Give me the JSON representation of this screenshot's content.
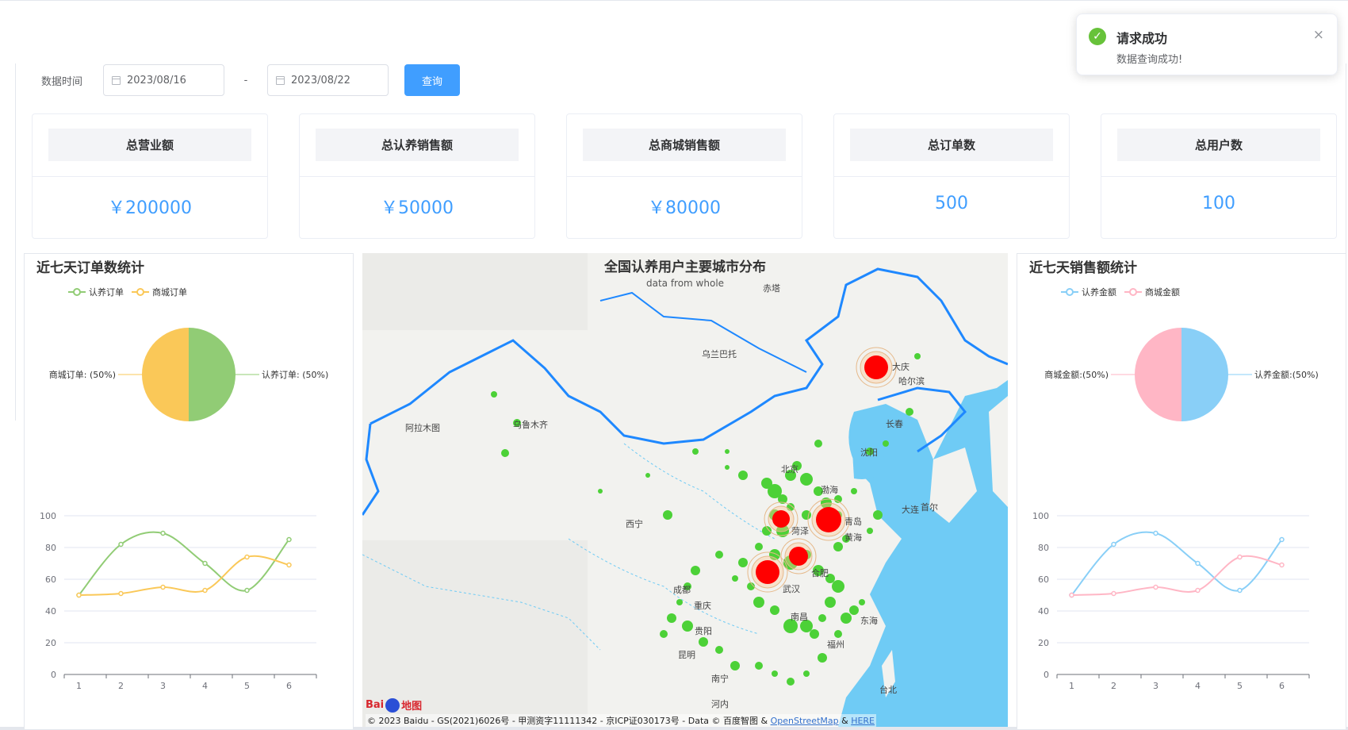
{
  "filter": {
    "label": "数据时间",
    "start_date": "2023/08/16",
    "separator": "-",
    "end_date": "2023/08/22",
    "query_button": "查询"
  },
  "cards": [
    {
      "title": "总营业额",
      "value": "￥200000"
    },
    {
      "title": "总认养销售额",
      "value": "￥50000"
    },
    {
      "title": "总商城销售额",
      "value": "￥80000"
    },
    {
      "title": "总订单数",
      "value": "500"
    },
    {
      "title": "总用户数",
      "value": "100"
    }
  ],
  "toast": {
    "title": "请求成功",
    "message": "数据查询成功!",
    "close": "×",
    "icon": "success-check-icon"
  },
  "colors": {
    "accent": "#409eff",
    "green": "#91cc75",
    "yellow": "#fac858",
    "blue": "#89cff7",
    "pink": "#ffb6c5",
    "map_red": "#ff0000",
    "map_green": "#4cd137",
    "sea": "#6fcbf5",
    "border": "#1e88ff"
  },
  "left_panel": {
    "title": "近七天订单数统计",
    "legend": [
      "认养订单",
      "商城订单"
    ]
  },
  "right_panel": {
    "title": "近七天销售额统计",
    "legend": [
      "认养金额",
      "商城金额"
    ]
  },
  "map": {
    "title": "全国认养用户主要城市分布",
    "subtitle": "data from whole",
    "copyright_prefix": "© 2023 Baidu - GS(2021)6026号 - 甲测资字11111342 - 京ICP证030173号 - Data © 百度智图 & ",
    "osm": "OpenStreetMap",
    "amp": " & ",
    "here": "HERE",
    "logo_left": "Bai",
    "logo_right": "地图",
    "labels": [
      "大庆",
      "哈尔滨",
      "长春",
      "乌兰巴托",
      "乌鲁木齐",
      "阿拉木图",
      "北京",
      "渤海",
      "青岛",
      "黄海",
      "菏泽",
      "合肥",
      "武汉",
      "东海",
      "西宁",
      "成都",
      "重庆",
      "贵阳",
      "昆明",
      "南宁",
      "福州",
      "台北",
      "南昌",
      "沈阳",
      "大连",
      "首尔",
      "赤塔",
      "河内"
    ]
  },
  "chart_data": [
    {
      "type": "pie",
      "title": "近七天订单数统计",
      "series": [
        {
          "name": "认养订单",
          "value": 50,
          "label": "认养订单: (50%)"
        },
        {
          "name": "商城订单",
          "value": 50,
          "label": "商城订单: (50%)"
        }
      ]
    },
    {
      "type": "line",
      "x": [
        1,
        2,
        3,
        4,
        5,
        6
      ],
      "ylim": [
        0,
        100
      ],
      "yticks": [
        0,
        20,
        40,
        60,
        80,
        100
      ],
      "series": [
        {
          "name": "认养订单",
          "values": [
            50,
            82,
            89,
            70,
            53,
            85
          ]
        },
        {
          "name": "商城订单",
          "values": [
            50,
            51,
            55,
            53,
            74,
            69
          ]
        }
      ]
    },
    {
      "type": "pie",
      "title": "近七天销售额统计",
      "series": [
        {
          "name": "认养金额",
          "value": 50,
          "label": "认养金额:(50%)"
        },
        {
          "name": "商城金额",
          "value": 50,
          "label": "商城金额:(50%)"
        }
      ]
    },
    {
      "type": "line",
      "x": [
        1,
        2,
        3,
        4,
        5,
        6
      ],
      "ylim": [
        0,
        100
      ],
      "yticks": [
        0,
        20,
        40,
        60,
        80,
        100
      ],
      "series": [
        {
          "name": "认养金额",
          "values": [
            50,
            82,
            89,
            70,
            53,
            85
          ]
        },
        {
          "name": "商城金额",
          "values": [
            50,
            51,
            55,
            53,
            74,
            69
          ]
        }
      ]
    }
  ]
}
